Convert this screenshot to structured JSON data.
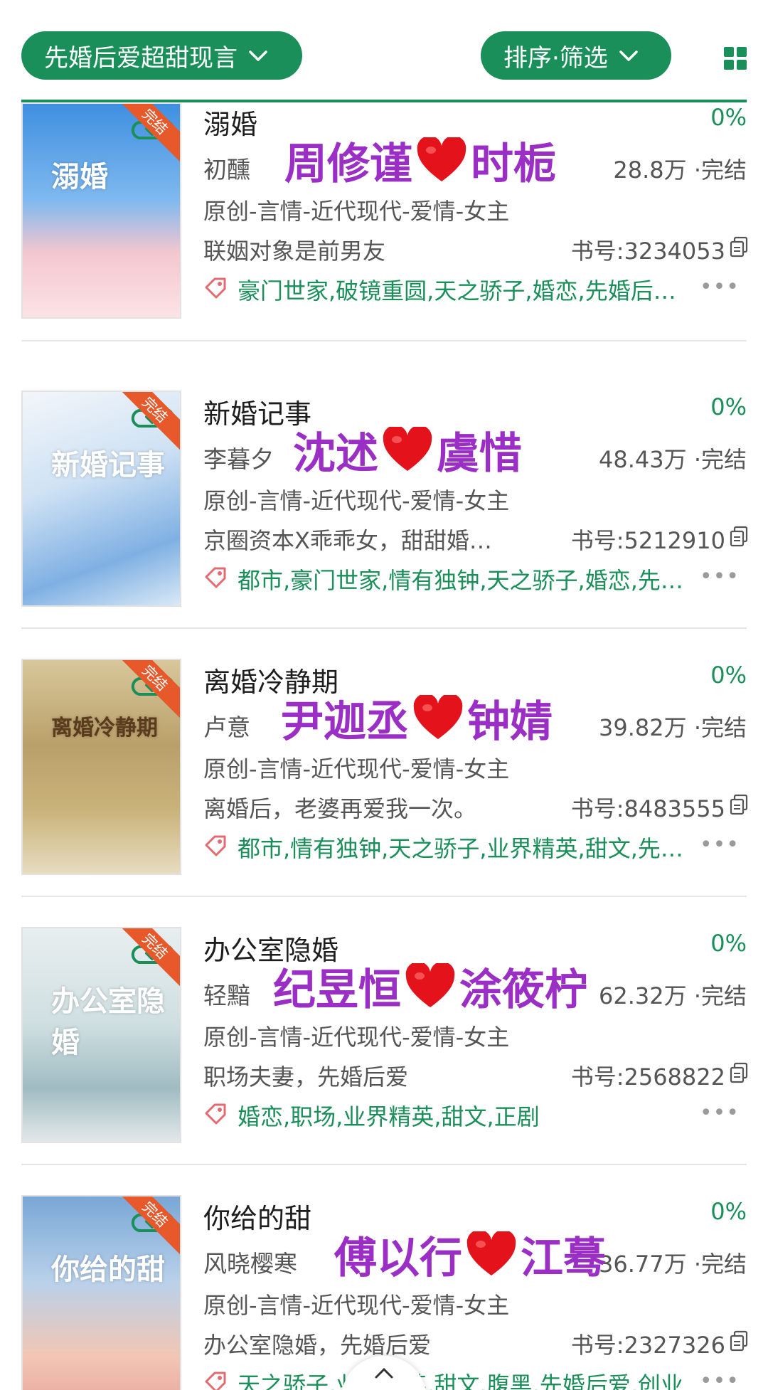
{
  "filters": {
    "category_label": "先婚后爱超甜现言",
    "sort_label": "排序·筛选"
  },
  "colors": {
    "accent": "#1a8f5a",
    "overlay": "#9b2fc5",
    "heart": "#e3121b",
    "ribbon": "#e7582a"
  },
  "icons": [
    "chevron-down-icon",
    "grid-view-icon",
    "download-icon",
    "copy-icon",
    "tag-icon",
    "more-icon",
    "heart-icon",
    "chevron-up-icon"
  ],
  "books": [
    {
      "title": "溺婚",
      "author": "初醺",
      "progress": "0%",
      "stats": "28.8万 ·完结",
      "category": "原创-言情-近代现代-爱情-女主",
      "intro": "联姻对象是前男友",
      "book_no": "书号:3234053",
      "tags": "豪门世家,破镜重圆,天之骄子,婚恋,先婚后…",
      "cover_text": "溺婚",
      "ribbon": "完结",
      "couple_left": "周修谨",
      "couple_right": "时栀"
    },
    {
      "title": "新婚记事",
      "author": "李暮夕",
      "progress": "0%",
      "stats": "48.43万 ·完结",
      "category": "原创-言情-近代现代-爱情-女主",
      "intro": "京圈资本X乖乖女，甜甜婚…",
      "book_no": "书号:5212910",
      "tags": "都市,豪门世家,情有独钟,天之骄子,婚恋,先…",
      "cover_text": "新婚记事",
      "ribbon": "完结",
      "couple_left": "沈述",
      "couple_right": "虞惜"
    },
    {
      "title": "离婚冷静期",
      "author": "卢意",
      "progress": "0%",
      "stats": "39.82万 ·完结",
      "category": "原创-言情-近代现代-爱情-女主",
      "intro": "离婚后，老婆再爱我一次。",
      "book_no": "书号:8483555",
      "tags": "都市,情有独钟,天之骄子,业界精英,甜文,先…",
      "cover_text": "离婚冷静期",
      "ribbon": "完结",
      "couple_left": "尹迦丞",
      "couple_right": "钟婧"
    },
    {
      "title": "办公室隐婚",
      "author": "轻黯",
      "progress": "0%",
      "stats": "62.32万 ·完结",
      "category": "原创-言情-近代现代-爱情-女主",
      "intro": "职场夫妻，先婚后爱",
      "book_no": "书号:2568822",
      "tags": "婚恋,职场,业界精英,甜文,正剧",
      "cover_text": "办公室隐婚",
      "ribbon": "完结",
      "couple_left": "纪昱恒",
      "couple_right": "涂筱柠"
    },
    {
      "title": "你给的甜",
      "author": "风晓樱寒",
      "progress": "0%",
      "stats": "36.77万 ·完结",
      "category": "原创-言情-近代现代-爱情-女主",
      "intro": "办公室隐婚，先婚后爱",
      "book_no": "书号:2327326",
      "tags": "天之骄子,业界精英,甜文,腹黑,先婚后爱,创业…",
      "cover_text": "你给的甜",
      "ribbon": "完结",
      "couple_left": "傅以行",
      "couple_right": "江蓦"
    }
  ],
  "more_label": "•••"
}
